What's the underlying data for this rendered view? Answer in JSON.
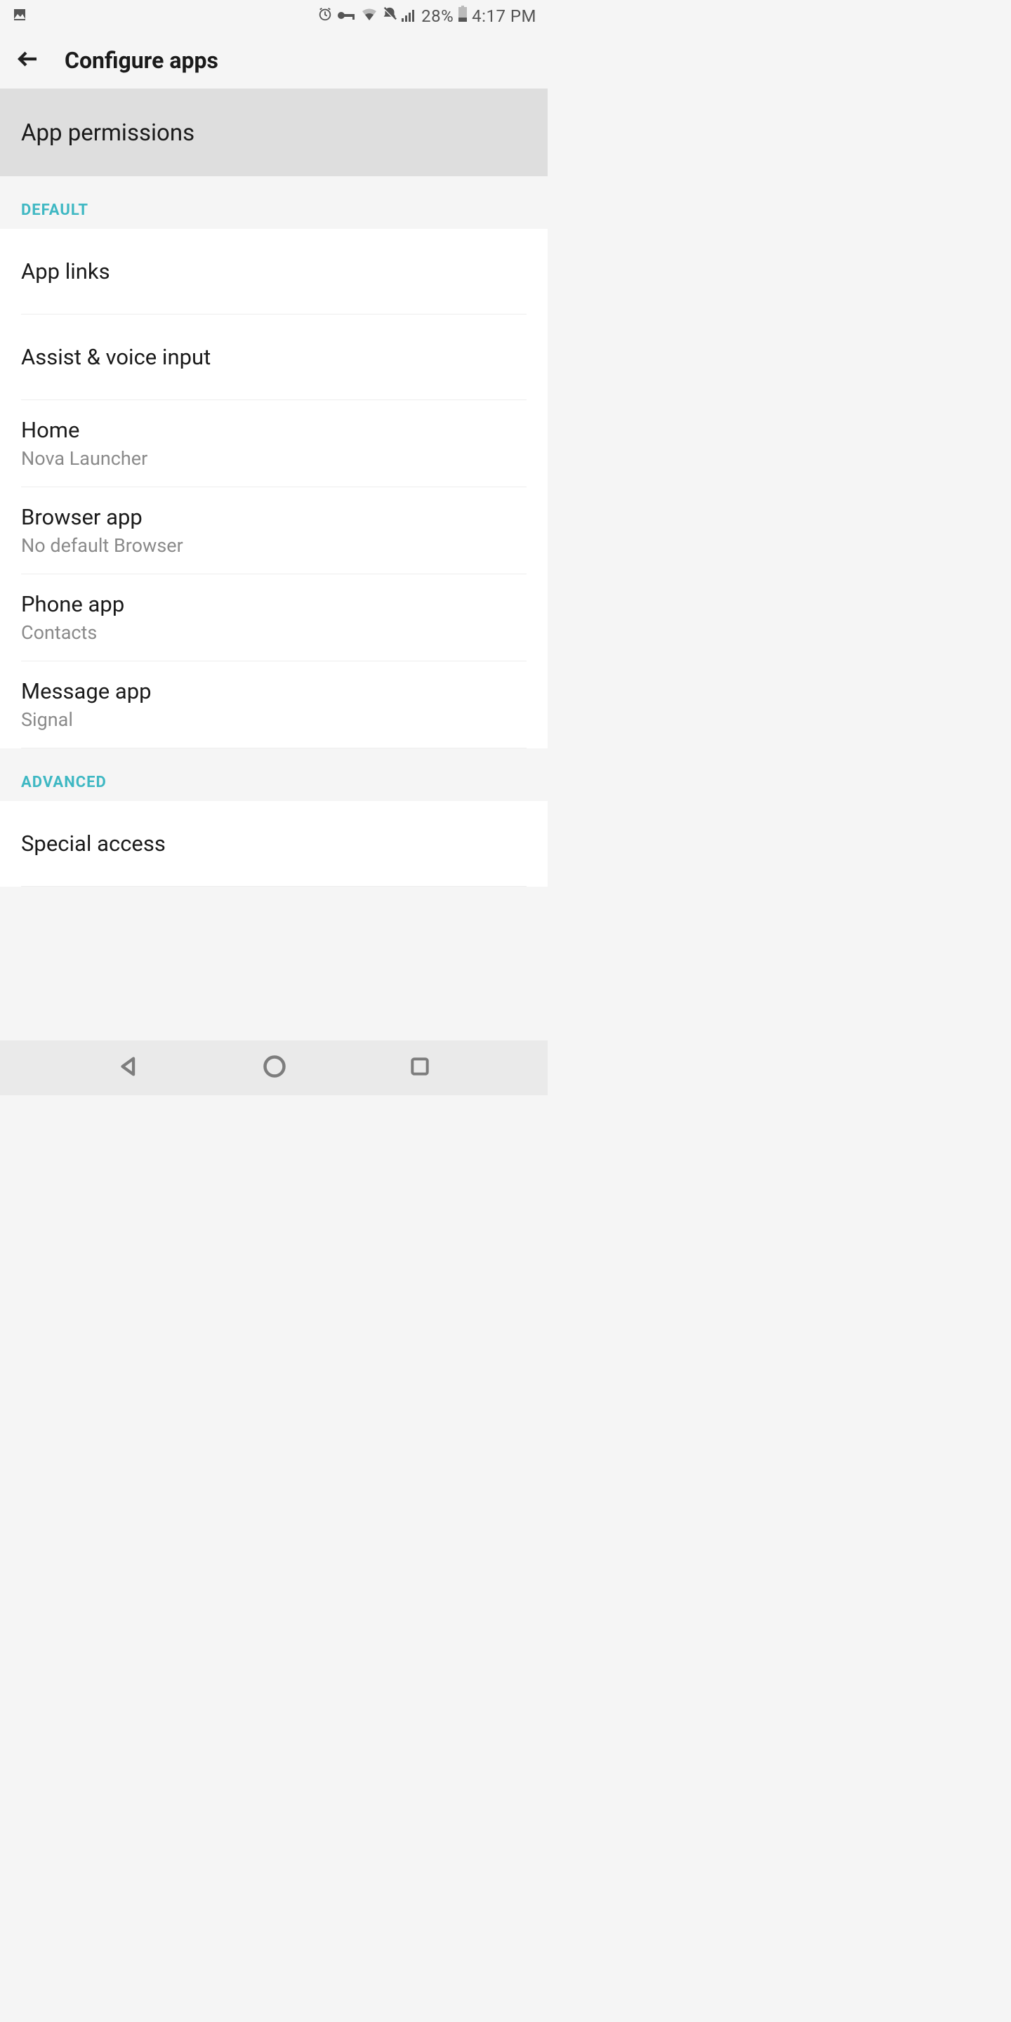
{
  "status_bar": {
    "battery_text": "28%",
    "time": "4:17 PM"
  },
  "app_bar": {
    "title": "Configure apps"
  },
  "permissions": {
    "title": "App permissions"
  },
  "sections": {
    "default_header": "DEFAULT",
    "advanced_header": "ADVANCED"
  },
  "default_items": [
    {
      "title": "App links",
      "subtitle": null
    },
    {
      "title": "Assist & voice input",
      "subtitle": null
    },
    {
      "title": "Home",
      "subtitle": "Nova Launcher"
    },
    {
      "title": "Browser app",
      "subtitle": "No default Browser"
    },
    {
      "title": "Phone app",
      "subtitle": "Contacts"
    },
    {
      "title": "Message app",
      "subtitle": "Signal"
    }
  ],
  "advanced_items": [
    {
      "title": "Special access",
      "subtitle": null
    }
  ]
}
